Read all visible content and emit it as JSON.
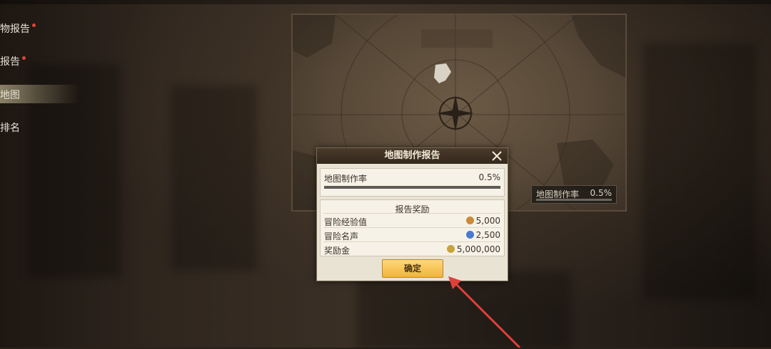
{
  "sidebar": {
    "items": [
      {
        "label": "物报告",
        "badge": true
      },
      {
        "label": "报告",
        "badge": true
      },
      {
        "label": "地图",
        "badge": false
      },
      {
        "label": "排名",
        "badge": false
      }
    ]
  },
  "map": {
    "mini_label": "地图制作率",
    "mini_value": "0.5%",
    "progress": 0.005
  },
  "dialog": {
    "title": "地图制作报告",
    "progress_label": "地图制作率",
    "progress_value": "0.5%",
    "rewards_title": "报告奖励",
    "rewards": [
      {
        "label": "冒险经验值",
        "value": "5,000",
        "icon": "exp-icon",
        "color": "#c98a3a"
      },
      {
        "label": "冒险名声",
        "value": "2,500",
        "icon": "fame-icon",
        "color": "#4a7bd0"
      },
      {
        "label": "奖励金",
        "value": "5,000,000",
        "icon": "coin-icon",
        "color": "#c9a33a"
      }
    ],
    "confirm_label": "确定"
  },
  "colors": {
    "accent_button": "#f1b53b",
    "annotation_arrow": "#e0403a",
    "badge": "#e0443a"
  }
}
